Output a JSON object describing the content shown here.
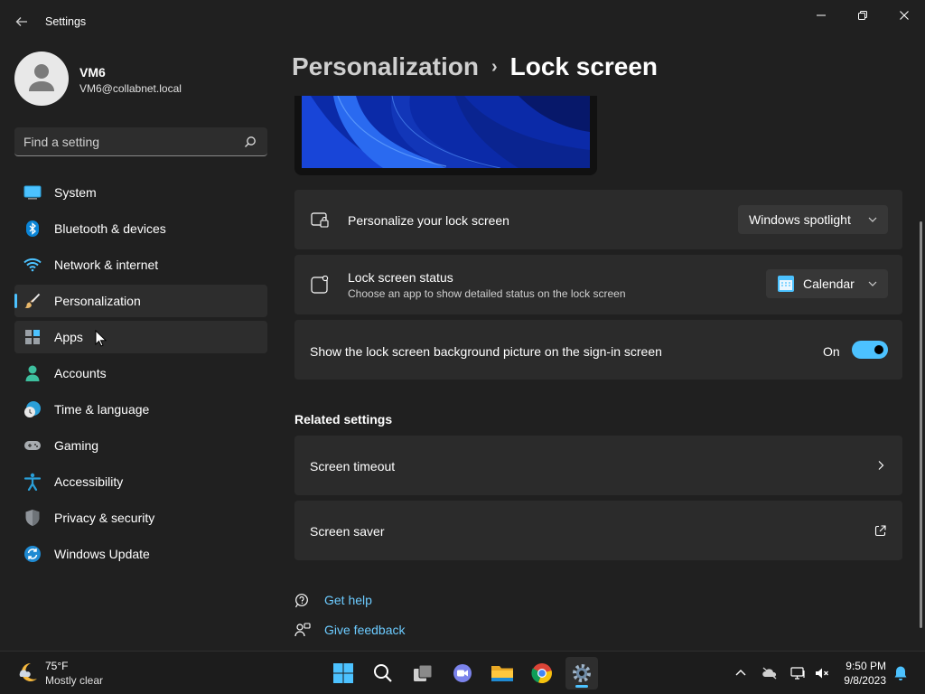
{
  "window": {
    "title": "Settings"
  },
  "profile": {
    "name": "VM6",
    "email": "VM6@collabnet.local"
  },
  "search": {
    "placeholder": "Find a setting"
  },
  "nav": {
    "items": [
      {
        "label": "System",
        "icon": "system-icon"
      },
      {
        "label": "Bluetooth & devices",
        "icon": "bluetooth-icon"
      },
      {
        "label": "Network & internet",
        "icon": "wifi-icon"
      },
      {
        "label": "Personalization",
        "icon": "paintbrush-icon",
        "active": true
      },
      {
        "label": "Apps",
        "icon": "apps-icon"
      },
      {
        "label": "Accounts",
        "icon": "person-icon"
      },
      {
        "label": "Time & language",
        "icon": "clock-globe-icon"
      },
      {
        "label": "Gaming",
        "icon": "gamepad-icon"
      },
      {
        "label": "Accessibility",
        "icon": "accessibility-icon"
      },
      {
        "label": "Privacy & security",
        "icon": "shield-icon"
      },
      {
        "label": "Windows Update",
        "icon": "update-icon"
      }
    ]
  },
  "breadcrumb": {
    "parent": "Personalization",
    "separator": "›",
    "current": "Lock screen"
  },
  "settings": {
    "personalize": {
      "title": "Personalize your lock screen",
      "value": "Windows spotlight"
    },
    "status": {
      "title": "Lock screen status",
      "subtitle": "Choose an app to show detailed status on the lock screen",
      "value": "Calendar"
    },
    "signin_bg": {
      "title": "Show the lock screen background picture on the sign-in screen",
      "state_label": "On",
      "on": true
    }
  },
  "related": {
    "heading": "Related settings",
    "items": [
      {
        "label": "Screen timeout",
        "icon": "chevron-right-icon"
      },
      {
        "label": "Screen saver",
        "icon": "external-link-icon"
      }
    ]
  },
  "help": {
    "get_help": "Get help",
    "give_feedback": "Give feedback"
  },
  "taskbar": {
    "weather_temp": "75°F",
    "weather_desc": "Mostly clear",
    "time": "9:50 PM",
    "date": "9/8/2023"
  },
  "colors": {
    "accent": "#4cc2ff",
    "background": "#202020",
    "card": "#2b2b2b"
  }
}
